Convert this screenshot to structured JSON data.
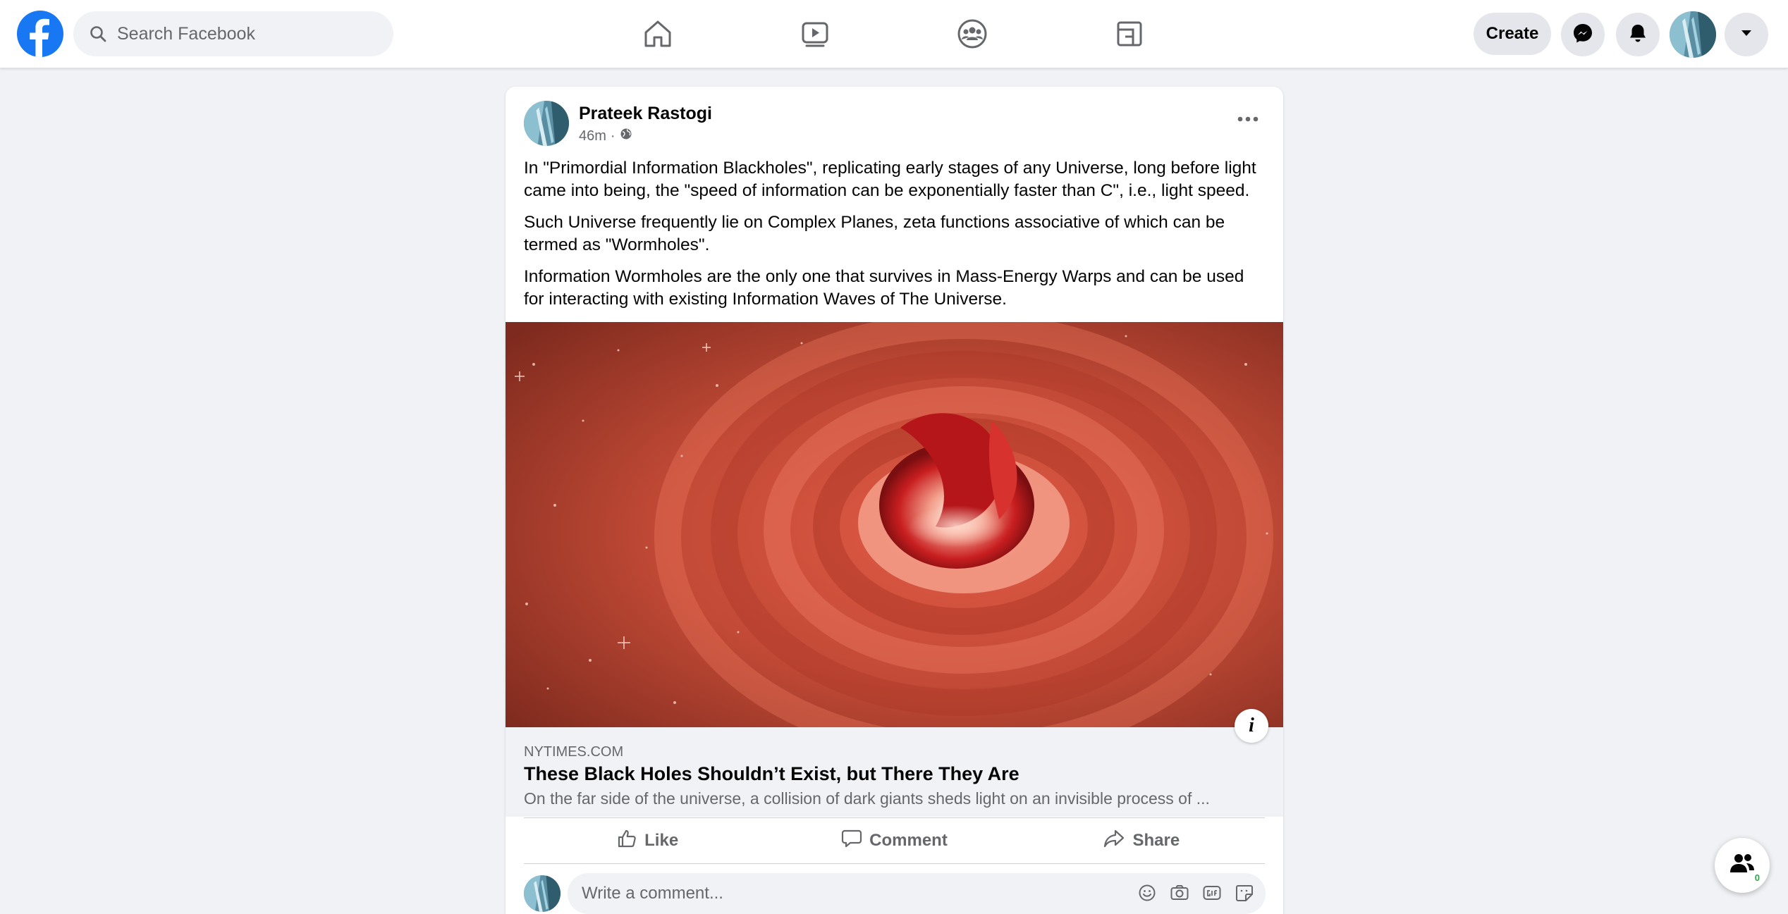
{
  "topbar": {
    "logo": "facebook-logo",
    "search_placeholder": "Search Facebook",
    "nav_icons": [
      "home-icon",
      "video-icon",
      "groups-icon",
      "gaming-icon"
    ],
    "create_label": "Create",
    "right_icons": [
      "messenger-icon",
      "notifications-icon",
      "account-menu-icon"
    ]
  },
  "post": {
    "author": "Prateek Rastogi",
    "time": "46m",
    "privacy_icon": "globe-icon",
    "paragraphs": [
      "In \"Primordial Information Blackholes\", replicating early stages of any Universe, long before light came into being, the \"speed of information can be exponentially faster than C\", i.e., light speed.",
      "Such Universe frequently lie on Complex Planes, zeta functions associative of which can be termed as \"Wormholes\".",
      "Information Wormholes are the only one that survives in Mass-Energy Warps and can be used for interacting with existing Information Waves of The Universe."
    ],
    "link": {
      "domain": "NYTIMES.COM",
      "title": "These Black Holes Shouldn’t Exist, but There They Are",
      "description": "On the far side of the universe, a collision of dark giants sheds light on an invisible process of ...",
      "info_icon": "i"
    },
    "actions": {
      "like": "Like",
      "comment": "Comment",
      "share": "Share"
    },
    "comment_placeholder": "Write a comment...",
    "comment_icons": [
      "emoji-icon",
      "camera-icon",
      "gif-icon",
      "sticker-icon"
    ]
  },
  "contacts_button": {
    "count": "0"
  },
  "colors": {
    "brand": "#1877f2",
    "background": "#f0f2f5",
    "secondary_text": "#65676b"
  }
}
